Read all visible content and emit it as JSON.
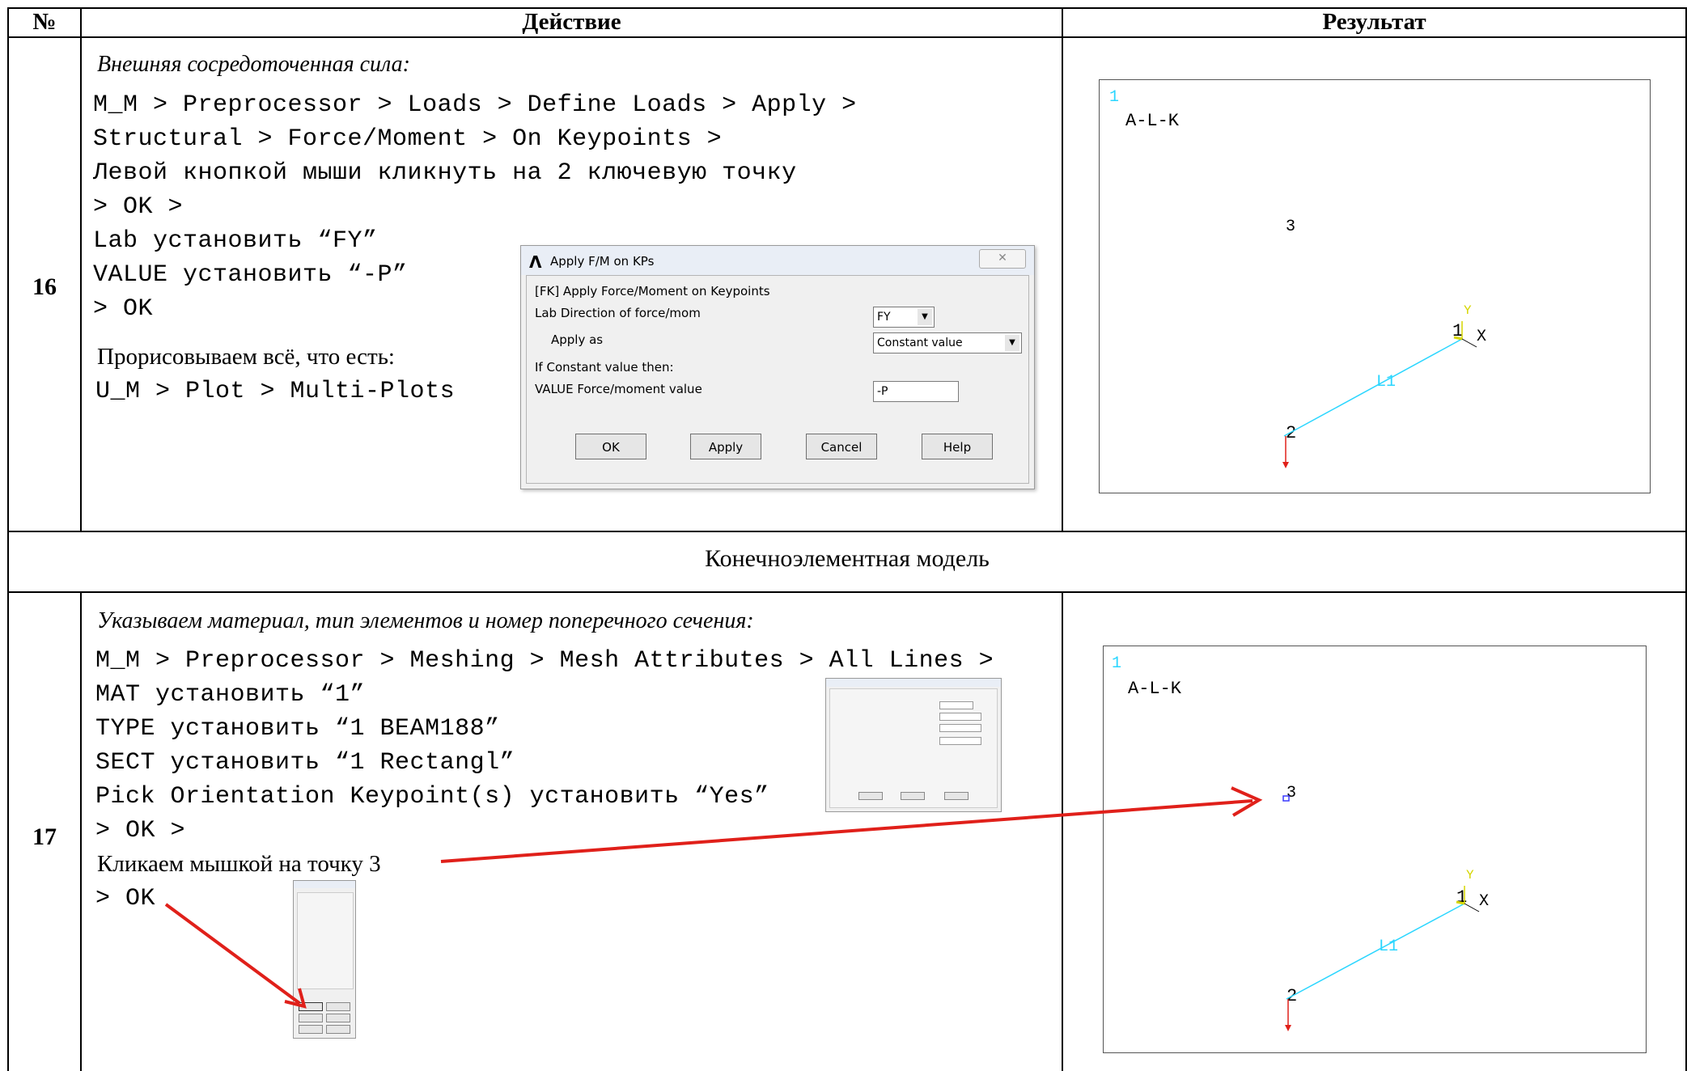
{
  "table": {
    "col_num": "№",
    "col_action": "Действие",
    "col_result": "Результат",
    "section": "Конечноэлементная модель"
  },
  "row16": {
    "num": "16",
    "heading": "Внешняя сосредоточенная сила:",
    "lines": [
      "M_M > Preprocessor > Loads > Define Loads > Apply >",
      "Structural > Force/Moment > On Keypoints >",
      "Левой кнопкой мыши кликнуть на 2 ключевую точку",
      "> OK >",
      "Lab установить “FY”",
      "VALUE установить “-P”",
      "> OK"
    ],
    "redraw_text": "Прорисовываем всё, что есть:",
    "redraw_path": "U_M > Plot > Multi-Plots",
    "dialog": {
      "title": "Apply F/M on KPs",
      "header": "[FK]  Apply Force/Moment on Keypoints",
      "lab_label": "Lab    Direction of force/mom",
      "lab_value": "FY",
      "apply_as_label": "Apply as",
      "apply_as_value": "Constant value",
      "if_constant": "If Constant value then:",
      "value_label": "VALUE   Force/moment value",
      "value_value": "-P",
      "btn_ok": "OK",
      "btn_apply": "Apply",
      "btn_cancel": "Cancel",
      "btn_help": "Help"
    },
    "plot": {
      "window_num": "1",
      "title": "A-L-K",
      "kp3": "3",
      "kp1": "1",
      "kp2": "2",
      "line": "L1",
      "axis_x": "X",
      "axis_y": "Y"
    }
  },
  "row17": {
    "num": "17",
    "heading": "Указываем материал, тип элементов и номер поперечного сечения:",
    "lines": [
      "M_M > Preprocessor > Meshing > Mesh Attributes > All Lines >",
      "MAT установить “1”",
      "TYPE установить “1 BEAM188”",
      "SECT установить “1 Rectangl”",
      "Pick Orientation Keypoint(s) установить “Yes”",
      "> OK >"
    ],
    "click_text": "Кликаем мышкой на точку 3",
    "ok_text": "> OK",
    "plot": {
      "window_num": "1",
      "title": "A-L-K",
      "kp3": "3",
      "kp1": "1",
      "kp2": "2",
      "line": "L1",
      "axis_x": "X",
      "axis_y": "Y"
    }
  },
  "colors": {
    "accent_red": "#e0201a",
    "line_cyan": "#2bd6ff",
    "axis_yellow": "#e8e800"
  }
}
